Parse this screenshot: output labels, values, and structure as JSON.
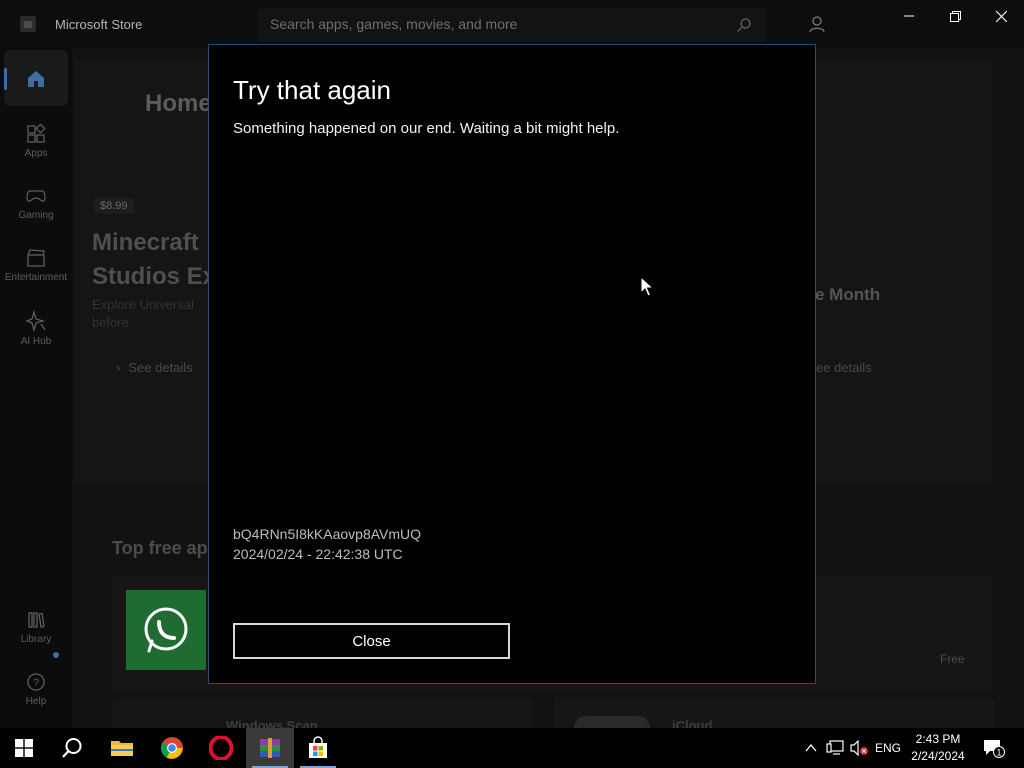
{
  "window": {
    "title": "Microsoft Store",
    "search_placeholder": "Search apps, games, movies, and more"
  },
  "nav": {
    "items": [
      {
        "label": "Apps",
        "icon": "apps-icon"
      },
      {
        "label": "Gaming",
        "icon": "gamepad-icon"
      },
      {
        "label": "Entertainment",
        "icon": "clapperboard-icon"
      },
      {
        "label": "AI Hub",
        "icon": "ai-sparkle-icon"
      },
      {
        "label": "Library",
        "icon": "library-icon"
      },
      {
        "label": "Help",
        "icon": "help-icon"
      }
    ]
  },
  "page": {
    "title": "Home",
    "hero": {
      "price": "$8.99",
      "title_line1": "Minecraft",
      "title_line2": "Studios Ex",
      "desc_line1": "Explore Universal",
      "desc_line2": "before",
      "see_details": "See details",
      "right_text": "e Month",
      "right_see_details": "ee details"
    },
    "section_title": "Top free ap",
    "free_label": "Free",
    "bottom_left_title": "Windows Scan",
    "bottom_right_title": "iCloud"
  },
  "dialog": {
    "title": "Try that again",
    "message": "Something happened on our end. Waiting a bit might help.",
    "code": "bQ4RNn5I8kKAaovp8AVmUQ",
    "timestamp": "2024/02/24 - 22:42:38 UTC",
    "close_label": "Close"
  },
  "taskbar": {
    "language": "ENG",
    "time": "2:43 PM",
    "date": "2/24/2024",
    "notification_count": "1"
  },
  "colors": {
    "dialog_border": "#2c4c77",
    "accent": "#3b6ea5",
    "whatsapp_green": "#1f6b31"
  }
}
